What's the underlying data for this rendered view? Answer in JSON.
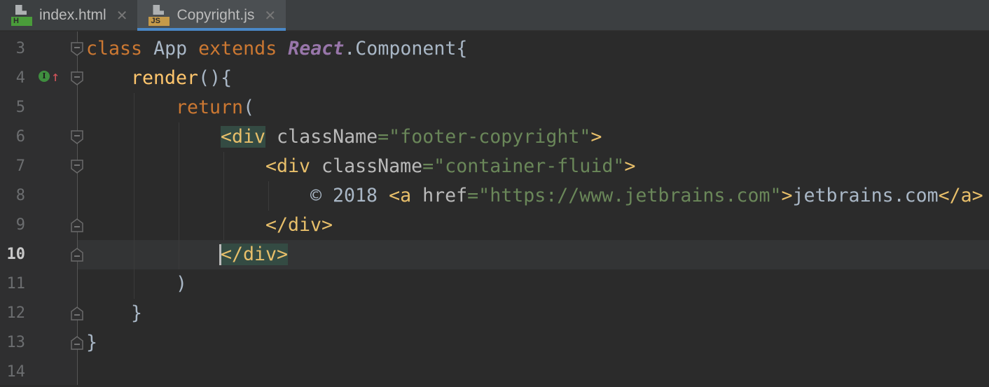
{
  "tabs": [
    {
      "label": "index.html",
      "badge": "H",
      "badge_color": "#4a9c3a",
      "active": false
    },
    {
      "label": "Copyright.js",
      "badge": "JS",
      "badge_color": "#c59a4a",
      "active": true
    }
  ],
  "gutter": {
    "implements_icon": "I",
    "current_line": "10"
  },
  "lines": [
    {
      "n": "3",
      "indent": 0,
      "fold": "start",
      "tokens": [
        [
          "kw",
          "class "
        ],
        [
          "id",
          "App "
        ],
        [
          "kw",
          "extends "
        ],
        [
          "cls",
          "React"
        ],
        [
          "id",
          ".Component{"
        ]
      ]
    },
    {
      "n": "4",
      "indent": 4,
      "fold": "start",
      "tokens": [
        [
          "fn",
          "render"
        ],
        [
          "id",
          "(){"
        ]
      ]
    },
    {
      "n": "5",
      "indent": 8,
      "fold": "",
      "tokens": [
        [
          "kw",
          "return"
        ],
        [
          "id",
          "("
        ]
      ]
    },
    {
      "n": "6",
      "indent": 12,
      "fold": "start",
      "tokens": [
        [
          "tag hl",
          "<div"
        ],
        [
          "attr",
          " className"
        ],
        [
          "str",
          "=\"footer-copyright\""
        ],
        [
          "tag",
          ">"
        ]
      ]
    },
    {
      "n": "7",
      "indent": 16,
      "fold": "start",
      "tokens": [
        [
          "tag",
          "<div"
        ],
        [
          "attr",
          " className"
        ],
        [
          "str",
          "=\"container-fluid\""
        ],
        [
          "tag",
          ">"
        ]
      ]
    },
    {
      "n": "8",
      "indent": 20,
      "fold": "",
      "tokens": [
        [
          "txt",
          "© 2018 "
        ],
        [
          "tag",
          "<a"
        ],
        [
          "attr",
          " href"
        ],
        [
          "str",
          "=\"https://www.jetbrains.com\""
        ],
        [
          "tag",
          ">"
        ],
        [
          "txt",
          "jetbrains.com"
        ],
        [
          "tag",
          "</a>"
        ]
      ]
    },
    {
      "n": "9",
      "indent": 16,
      "fold": "end",
      "tokens": [
        [
          "tag",
          "</div>"
        ]
      ]
    },
    {
      "n": "10",
      "indent": 12,
      "fold": "end",
      "tokens": [
        [
          "tag hl",
          "</div>"
        ]
      ]
    },
    {
      "n": "11",
      "indent": 8,
      "fold": "",
      "tokens": [
        [
          "id",
          ")"
        ]
      ]
    },
    {
      "n": "12",
      "indent": 4,
      "fold": "end",
      "tokens": [
        [
          "id",
          "}"
        ]
      ]
    },
    {
      "n": "13",
      "indent": 0,
      "fold": "end",
      "tokens": [
        [
          "id",
          "}"
        ]
      ]
    },
    {
      "n": "14",
      "indent": 0,
      "fold": "",
      "tokens": []
    }
  ]
}
